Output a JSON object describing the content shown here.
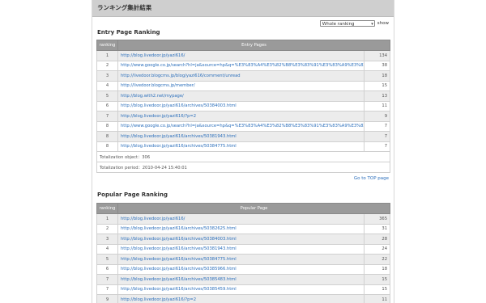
{
  "title": "ランキング集計結果",
  "select": {
    "value": "Whole ranking",
    "show_label": "show"
  },
  "entry": {
    "heading": "Entry Page Ranking",
    "col_ranking": "ranking",
    "col_pages": "Entry Pages",
    "rows": [
      {
        "rank": "1",
        "url": "http://blog.livedoor.jp/yazi616/",
        "count": "134"
      },
      {
        "rank": "2",
        "url": "http://www.google.co.jp/search?hl=ja&source=hp&q=%E3%83%A4%E3%82%B8%E3%83%91%E3%83%A9%E3%82%A4&...",
        "count": "38"
      },
      {
        "rank": "3",
        "url": "http://livedoor.blogcms.jp/blog/yazi616/comment/unread",
        "count": "18"
      },
      {
        "rank": "4",
        "url": "http://livedoor.blogcms.jp/member/",
        "count": "15"
      },
      {
        "rank": "5",
        "url": "http://blog.with2.net/mypage/",
        "count": "13"
      },
      {
        "rank": "6",
        "url": "http://blog.livedoor.jp/yazi616/archives/50384003.html",
        "count": "11"
      },
      {
        "rank": "7",
        "url": "http://blog.livedoor.jp/yazi616/?p=2",
        "count": "9"
      },
      {
        "rank": "8",
        "url": "http://www.google.co.jp/search?hl=ja&source=hp&q=%E3%83%A4%E3%82%B8%E3%83%91%E3%83%A9%E3%82%A4&...",
        "count": "7"
      },
      {
        "rank": "8",
        "url": "http://blog.livedoor.jp/yazi616/archives/50381943.html",
        "count": "7"
      },
      {
        "rank": "8",
        "url": "http://blog.livedoor.jp/yazi616/archives/50384775.html",
        "count": "7"
      }
    ],
    "total_object": "Totalization object：306",
    "total_period": "Totalization period：2010-04-24 15:40:01"
  },
  "top_link": "Go to TOP page",
  "popular": {
    "heading": "Popular Page Ranking",
    "col_ranking": "ranking",
    "col_pages": "Popular Page",
    "rows": [
      {
        "rank": "1",
        "url": "http://blog.livedoor.jp/yazi616/",
        "count": "365"
      },
      {
        "rank": "2",
        "url": "http://blog.livedoor.jp/yazi616/archives/50382625.html",
        "count": "31"
      },
      {
        "rank": "3",
        "url": "http://blog.livedoor.jp/yazi616/archives/50384003.html",
        "count": "28"
      },
      {
        "rank": "4",
        "url": "http://blog.livedoor.jp/yazi616/archives/50381943.html",
        "count": "24"
      },
      {
        "rank": "5",
        "url": "http://blog.livedoor.jp/yazi616/archives/50384775.html",
        "count": "22"
      },
      {
        "rank": "6",
        "url": "http://blog.livedoor.jp/yazi616/archives/50385966.html",
        "count": "18"
      },
      {
        "rank": "7",
        "url": "http://blog.livedoor.jp/yazi616/archives/50385483.html",
        "count": "15"
      },
      {
        "rank": "7",
        "url": "http://blog.livedoor.jp/yazi616/archives/50385459.html",
        "count": "15"
      },
      {
        "rank": "9",
        "url": "http://blog.livedoor.jp/yazi616/?p=2",
        "count": "11"
      }
    ]
  }
}
